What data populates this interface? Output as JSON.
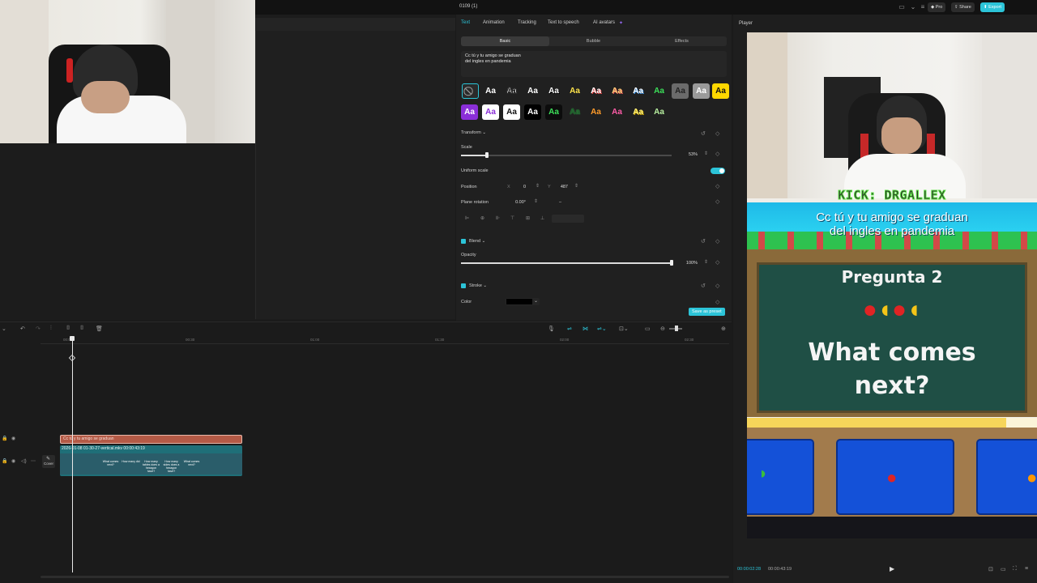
{
  "topbar": {
    "document_title": "0109 (1)",
    "pro_label": "Pro",
    "share_label": "Share",
    "export_label": "Export"
  },
  "properties": {
    "tabs": [
      "Text",
      "Animation",
      "Tracking",
      "Text to speech",
      "AI avatars"
    ],
    "active_tab": "Text",
    "subtabs": [
      "Basic",
      "Bubble",
      "Effects"
    ],
    "active_subtab": "Basic",
    "text_content_line1": "Cc tú y tu amigo se graduan",
    "text_content_line2": "del ingles en pandemia",
    "preset_label": "Aa",
    "transform": {
      "label": "Transform",
      "scale_label": "Scale",
      "scale_value": "53%",
      "scale_fraction": 0.53,
      "uniform_scale_label": "Uniform scale",
      "uniform_scale_on": true,
      "position_label": "Position",
      "x_label": "X",
      "x_value": "0",
      "y_label": "Y",
      "y_value": "487",
      "rotation_label": "Plane rotation",
      "rotation_value": "0.00°",
      "rotation_dash": "–"
    },
    "blend": {
      "label": "Blend",
      "opacity_label": "Opacity",
      "opacity_value": "100%",
      "opacity_fraction": 1.0
    },
    "stroke": {
      "label": "Stroke",
      "color_label": "Color",
      "color_value": "#000000"
    },
    "save_preset_label": "Save as preset"
  },
  "player": {
    "label": "Player",
    "current_time": "00:00:02:28",
    "total_time": "00:00:43:19",
    "video": {
      "banner_text": "KICK: DRGALLEX",
      "caption_line1": "Cc tú y tu amigo se graduan",
      "caption_line2": "del ingles en pandemia",
      "board_title": "Pregunta 2",
      "board_question_line1": "What comes",
      "board_question_line2": "next?"
    }
  },
  "timeline": {
    "ruler_labels": [
      "00:00",
      "00:30",
      "01:00",
      "01:30",
      "02:00",
      "02:30"
    ],
    "text_clip_label": "Cc tú y tu amigo se graduan",
    "video_clip_label": "2026-01-08 01-30-27-vertical.mkv   00:00:43:19",
    "cover_label": "Cover",
    "thumb_labels": [
      "",
      "",
      "What comes next?",
      "How many did",
      "How many tables does a hexagon have?",
      "How many sides does a hexagon have?",
      "What comes next?",
      "",
      ""
    ]
  },
  "colors": {
    "accent": "#2cc4d8",
    "text_clip": "#b45a46",
    "video_clip": "#1f6f78",
    "board_green": "#1f4f45"
  }
}
